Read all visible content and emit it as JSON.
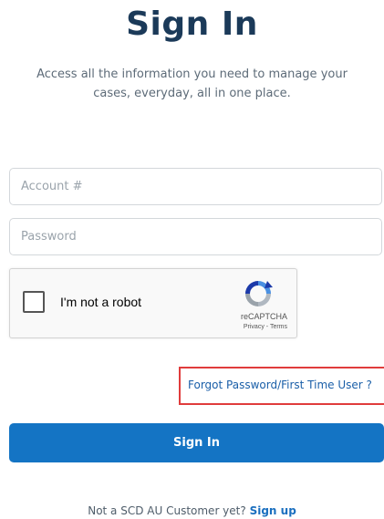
{
  "header": {
    "title": "Sign In",
    "subtitle": "Access all the information you need to manage your cases, everyday, all in one place."
  },
  "form": {
    "account_placeholder": "Account #",
    "password_placeholder": "Password"
  },
  "recaptcha": {
    "label": "I'm not a robot",
    "brand": "reCAPTCHA",
    "privacy": "Privacy",
    "separator": " - ",
    "terms": "Terms",
    "logo_icon": "recaptcha-logo-icon"
  },
  "links": {
    "forgot": "Forgot Password/First Time User ?"
  },
  "buttons": {
    "sign_in": "Sign In"
  },
  "footer": {
    "prompt": "Not a SCD AU Customer yet?",
    "signup": "Sign up"
  },
  "colors": {
    "primary": "#1474c4",
    "title": "#1b3a59",
    "link": "#1a5fa8",
    "highlight": "#e03c3c"
  }
}
